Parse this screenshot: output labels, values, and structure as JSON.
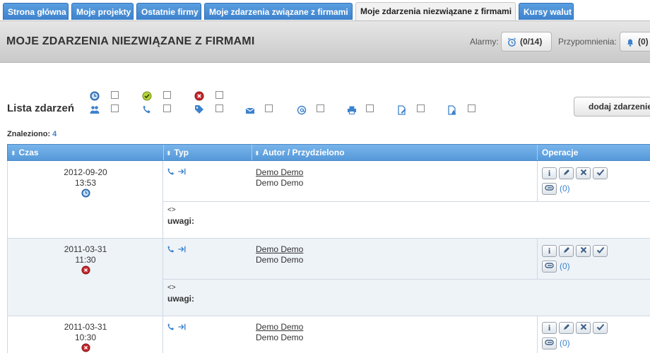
{
  "tabs": [
    {
      "label": "Strona główna"
    },
    {
      "label": "Moje projekty"
    },
    {
      "label": "Ostatnie firmy"
    },
    {
      "label": "Moje zdarzenia związane z firmami"
    },
    {
      "label": "Moje zdarzenia niezwiązane z firmami",
      "active": true
    },
    {
      "label": "Kursy walut"
    }
  ],
  "header": {
    "title": "MOJE ZDARZENIA NIEZWIĄZANE Z FIRMAMI",
    "alarms_label": "Alarmy:",
    "alarms_count": "(0/14)",
    "reminders_label": "Przypomnienia:",
    "reminders_count": "(0)"
  },
  "filters": {
    "title": "Lista zdarzeń",
    "icons": [
      "clock-icon",
      "check-icon",
      "error-icon",
      "users-icon",
      "phone-icon",
      "tag-icon",
      "mail-icon",
      "email-at-icon",
      "printer-icon",
      "document-edit-icon",
      "document-warning-icon"
    ],
    "add_button": "dodaj zdarzenie"
  },
  "found": {
    "label": "Znaleziono:",
    "count": "4"
  },
  "table": {
    "columns": [
      "Czas",
      "Typ",
      "Autor / Przydzielono",
      "Operacje"
    ],
    "rows": [
      {
        "date": "2012-09-20",
        "time": "13:53",
        "status": "clock-icon",
        "author": "Demo Demo",
        "assigned": "Demo Demo",
        "note_marker": "<>",
        "note_label": "uwagi:",
        "attachments": "(0)"
      },
      {
        "date": "2011-03-31",
        "time": "11:30",
        "status": "error-icon",
        "author": "Demo Demo",
        "assigned": "Demo Demo",
        "note_marker": "<>",
        "note_label": "uwagi:",
        "attachments": "(0)"
      },
      {
        "date": "2011-03-31",
        "time": "10:30",
        "status": "error-icon",
        "author": "Demo Demo",
        "assigned": "Demo Demo",
        "attachments": "(0)"
      }
    ]
  },
  "colors": {
    "accent": "#3d82cc",
    "tab": "#4a8fd6",
    "header_bg": "#d6d6d6"
  }
}
